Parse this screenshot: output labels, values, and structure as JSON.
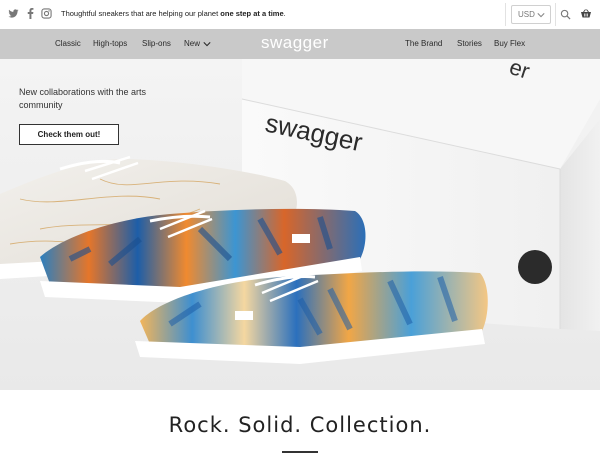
{
  "announcement": {
    "text_prefix": "Thoughtful sneakers that are helping our planet ",
    "text_bold": "one step at a time",
    "text_suffix": "."
  },
  "social": [
    "twitter-icon",
    "facebook-icon",
    "instagram-icon"
  ],
  "currency": {
    "selected": "USD"
  },
  "header_icons": [
    "search-icon",
    "cart-icon"
  ],
  "nav": {
    "left": [
      {
        "label": "Classic"
      },
      {
        "label": "High-tops"
      },
      {
        "label": "Slip-ons"
      },
      {
        "label": "New"
      }
    ],
    "logo": "swagger",
    "right": [
      {
        "label": "The Brand"
      },
      {
        "label": "Stories"
      },
      {
        "label": "Buy Flex"
      }
    ]
  },
  "hero": {
    "headline": "New collaborations with the arts community",
    "cta_label": "Check them out!",
    "box_brand": "swagger",
    "colors": {
      "background": "#efefef",
      "box": "#ffffff",
      "nav": "#c9c9c9"
    }
  },
  "section": {
    "title": "Rock. Solid. Collection."
  }
}
